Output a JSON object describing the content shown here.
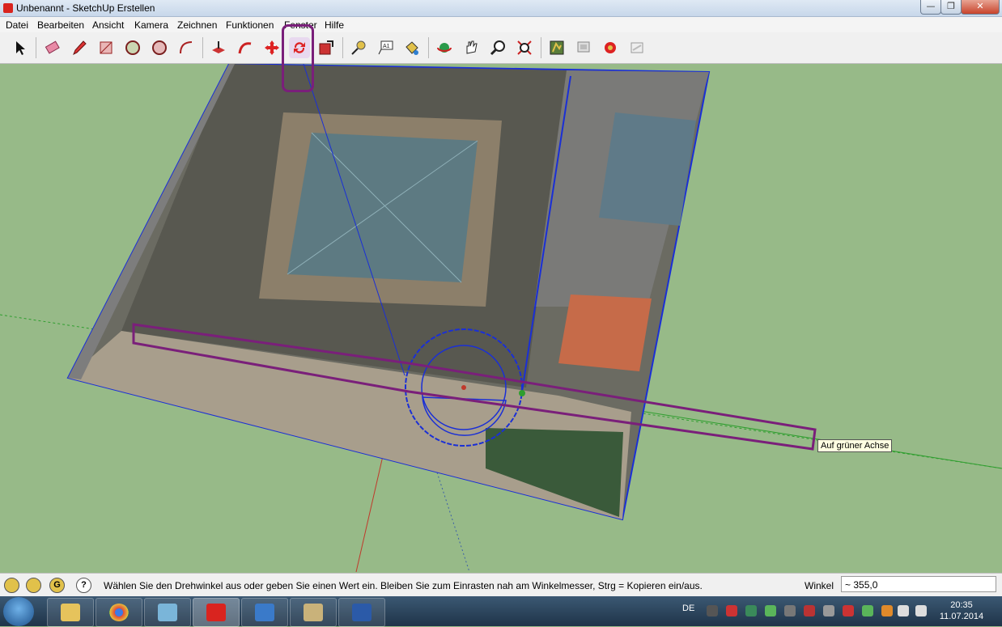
{
  "window": {
    "title": "Unbenannt - SketchUp Erstellen",
    "min_label": "—",
    "max_label": "❐",
    "close_label": "✕"
  },
  "menu": [
    "Datei",
    "Bearbeiten",
    "Ansicht",
    "Kamera",
    "Zeichnen",
    "Funktionen",
    "Fenster",
    "Hilfe"
  ],
  "toolbar": {
    "tools": [
      "select-tool",
      "eraser-tool",
      "pencil-tool",
      "rectangle-tool",
      "circle-tool",
      "polygon-tool",
      "arc-tool",
      "push-pull-tool",
      "follow-me-tool",
      "move-tool",
      "rotate-tool",
      "scale-tool",
      "tape-measure-tool",
      "text-tool",
      "paint-bucket-tool",
      "orbit-tool",
      "pan-tool",
      "zoom-tool",
      "zoom-extents-tool",
      "model-info-tool",
      "components-tool",
      "styles-tool",
      "shadows-tool"
    ],
    "selected": "rotate-tool"
  },
  "viewport": {
    "tooltip": "Auf grüner Achse"
  },
  "status": {
    "message": "Wählen Sie den Drehwinkel aus oder geben Sie einen Wert ein.  Bleiben Sie zum Einrasten nah am Winkelmesser, Strg = Kopieren ein/aus.",
    "vcb_label": "Winkel",
    "vcb_value": "~ 355,0",
    "help_icon": "?",
    "geo_icon": "G"
  },
  "taskbar": {
    "language": "DE",
    "time": "20:35",
    "date": "11.07.2014",
    "apps": [
      "explorer",
      "chrome",
      "app",
      "sketchup",
      "desktop",
      "photos",
      "word"
    ]
  },
  "colors": {
    "highlight": "#7a1f7a",
    "axis_green": "#2f9e2f",
    "axis_red": "#c0392b",
    "protractor": "#1a2fd6"
  }
}
